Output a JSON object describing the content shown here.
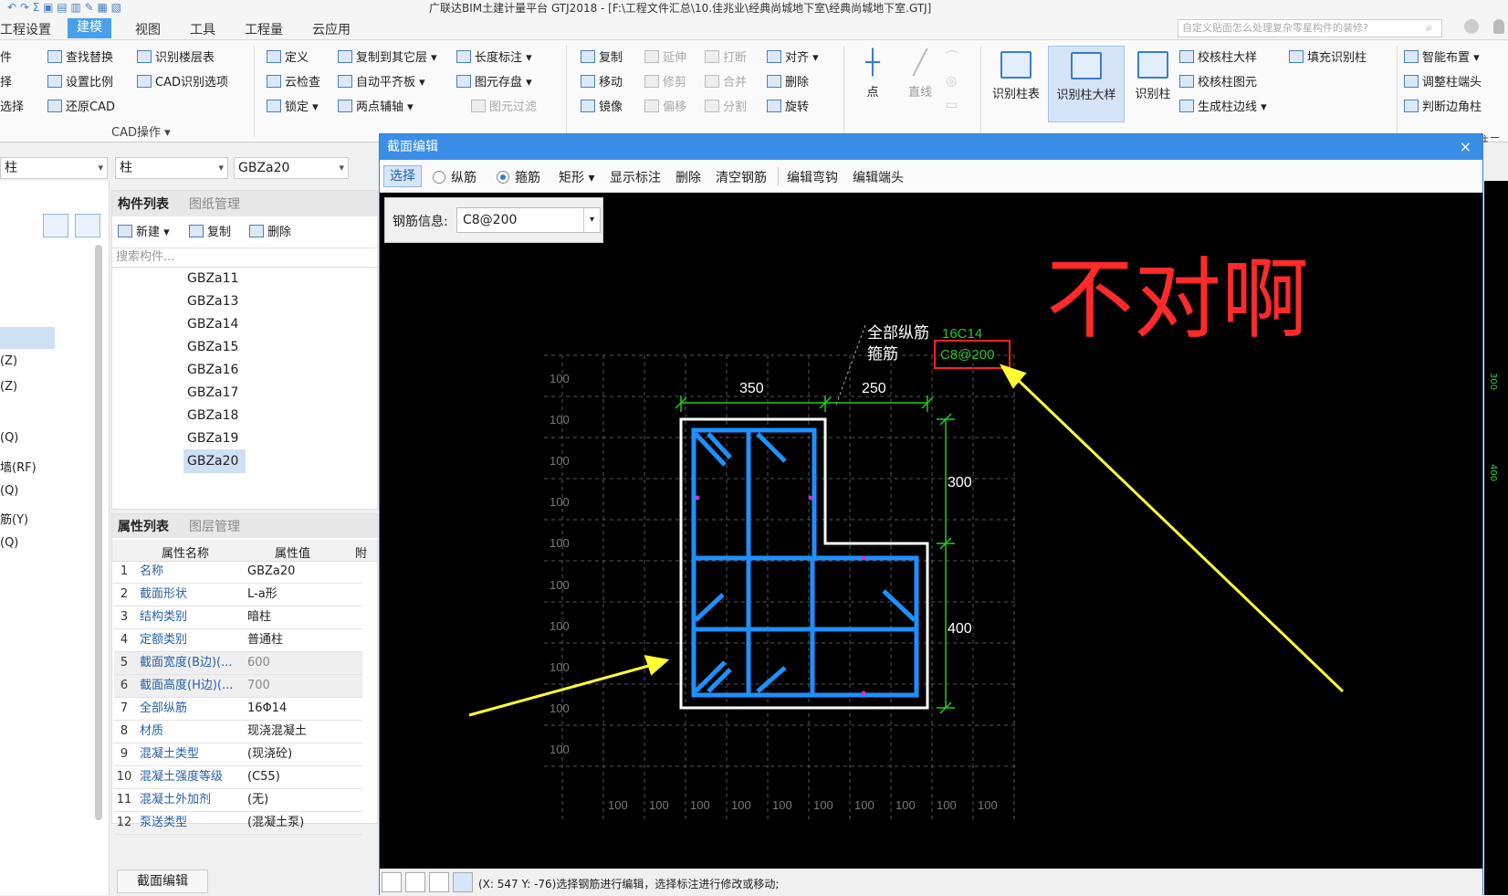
{
  "titlebar": {
    "title": "广联达BIM土建计量平台 GTJ2018 - [F:\\工程文件汇总\\10.佳兆业\\经典尚城地下室\\经典尚城地下室.GTJ]"
  },
  "menu": {
    "items": [
      "工程设置",
      "建模",
      "视图",
      "工具",
      "工程量",
      "云应用"
    ],
    "active": "建模",
    "search_placeholder": "自定义贴面怎么处理复杂零星构件的装修?"
  },
  "ribbon": {
    "left_cut": [
      "件",
      "择",
      "选择"
    ],
    "cad_ops": [
      "查找替换",
      "识别楼层表",
      "设置比例",
      "CAD识别选项",
      "还原CAD"
    ],
    "cad_caption": "CAD操作",
    "general": [
      "定义",
      "复制到其它层",
      "长度标注",
      "云检查",
      "自动平齐板",
      "图元存盘",
      "锁定",
      "两点辅轴",
      "图元过滤"
    ],
    "modify": [
      "复制",
      "延伸",
      "打断",
      "对齐",
      "移动",
      "修剪",
      "合并",
      "删除",
      "镜像",
      "偏移",
      "分割",
      "旋转"
    ],
    "draw": [
      "点",
      "直线"
    ],
    "recognize": [
      "识别柱表",
      "识别柱大样",
      "识别柱"
    ],
    "column_tools": [
      "校核柱大样",
      "填充识别柱",
      "校核柱图元",
      "生成柱边线"
    ],
    "right_tools": [
      "智能布置",
      "调整柱端头",
      "判断边角柱"
    ],
    "right_cut": "柱二次"
  },
  "selectors": {
    "type1": "柱",
    "type2": "柱",
    "component": "GBZa20"
  },
  "left_tree": [
    "(Z)",
    "(Z)",
    "(Q)",
    "墙(RF)",
    "(Q)",
    "筋(Y)",
    "(Q)"
  ],
  "component_panel": {
    "tabs": [
      "构件列表",
      "图纸管理"
    ],
    "actions": [
      "新建",
      "复制",
      "删除"
    ],
    "search_placeholder": "搜索构件...",
    "items": [
      "GBZa11",
      "GBZa13",
      "GBZa14",
      "GBZa15",
      "GBZa16",
      "GBZa17",
      "GBZa18",
      "GBZa19",
      "GBZa20"
    ],
    "selected": "GBZa20"
  },
  "property_panel": {
    "tabs": [
      "属性列表",
      "图层管理"
    ],
    "headers": [
      "属性名称",
      "属性值",
      "附"
    ],
    "rows": [
      [
        "1",
        "名称",
        "GBZa20"
      ],
      [
        "2",
        "截面形状",
        "L-a形"
      ],
      [
        "3",
        "结构类别",
        "暗柱"
      ],
      [
        "4",
        "定额类别",
        "普通柱"
      ],
      [
        "5",
        "截面宽度(B边)(...",
        "600"
      ],
      [
        "6",
        "截面高度(H边)(...",
        "700"
      ],
      [
        "7",
        "全部纵筋",
        "16Φ14"
      ],
      [
        "8",
        "材质",
        "现浇混凝土"
      ],
      [
        "9",
        "混凝土类型",
        "(现浇砼)"
      ],
      [
        "10",
        "混凝土强度等级",
        "(C55)"
      ],
      [
        "11",
        "混凝土外加剂",
        "(无)"
      ],
      [
        "12",
        "泵送类型",
        "(混凝土泵)"
      ]
    ],
    "bottom_tab": "截面编辑"
  },
  "dialog": {
    "title": "截面编辑",
    "close": "×",
    "toolbar": {
      "select": "选择",
      "radio_longitudinal": "纵筋",
      "radio_stirrup": "箍筋",
      "shape": "矩形",
      "show_label": "显示标注",
      "delete": "删除",
      "clear": "清空钢筋",
      "edit_hook": "编辑弯钩",
      "edit_end": "编辑端头"
    },
    "rebar_info": {
      "label": "钢筋信息:",
      "value": "C8@200"
    },
    "drawing": {
      "label_all": "全部纵筋",
      "label_all_value": "16C14",
      "label_stirrup": "箍筋",
      "label_stirrup_value": "C8@200",
      "dim_top_left": "350",
      "dim_top_right": "250",
      "dim_right_top": "300",
      "dim_right_bottom": "400",
      "grid_label": "100",
      "annotation": "不对啊"
    },
    "status": "(X: 547 Y: -76)选择钢筋进行编辑，选择标注进行修改或移动;"
  },
  "right_cut": [
    "300",
    "400"
  ]
}
